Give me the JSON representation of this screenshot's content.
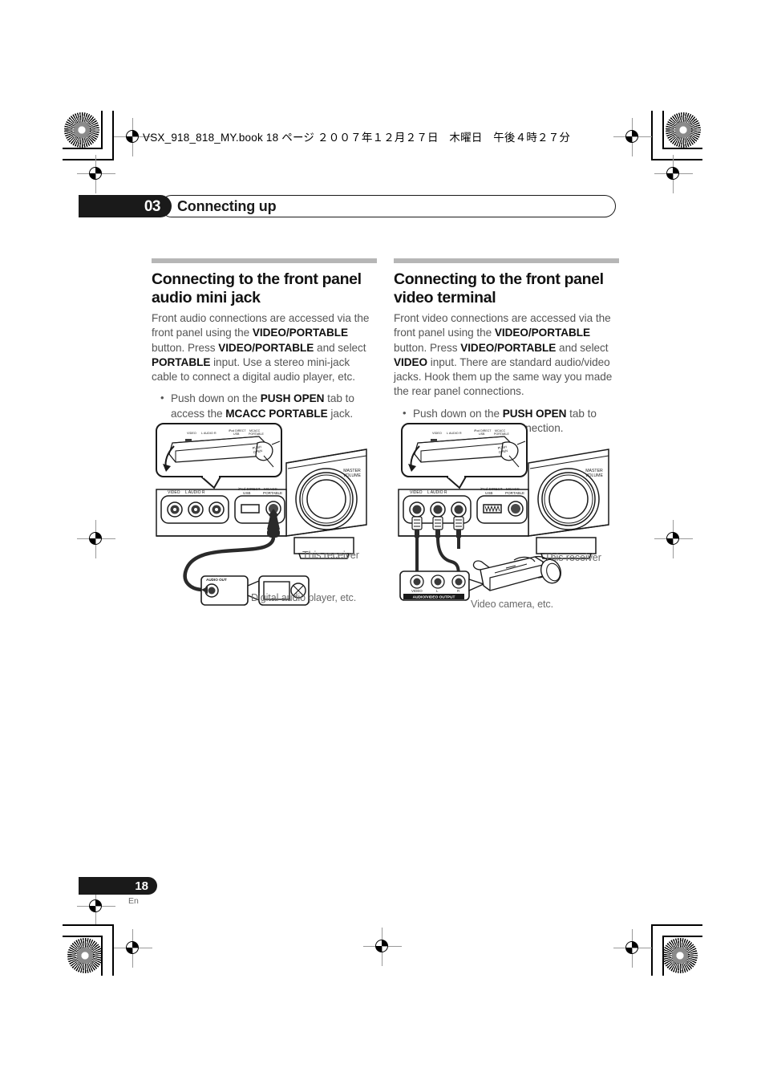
{
  "print_marks": {
    "filename_header": "VSX_918_818_MY.book 18 ページ ２００７年１２月２７日　木曜日　午後４時２７分"
  },
  "chapter": {
    "number": "03",
    "title": "Connecting up"
  },
  "left_column": {
    "heading": "Connecting to the front panel audio mini jack",
    "paragraph_parts": [
      {
        "text": "Front audio connections are accessed via the front panel using the ",
        "bold": false
      },
      {
        "text": "VIDEO/PORTABLE",
        "bold": true
      },
      {
        "text": " button. Press ",
        "bold": false
      },
      {
        "text": "VIDEO/PORTABLE",
        "bold": true
      },
      {
        "text": " and select ",
        "bold": false
      },
      {
        "text": "PORTABLE",
        "bold": true
      },
      {
        "text": " input. Use a stereo mini-jack cable to connect a digital audio player, etc.",
        "bold": false
      }
    ],
    "bullets": [
      [
        {
          "text": "Push down on the ",
          "bold": false
        },
        {
          "text": "PUSH OPEN",
          "bold": true
        },
        {
          "text": " tab to access the ",
          "bold": false
        },
        {
          "text": "MCACC PORTABLE",
          "bold": true
        },
        {
          "text": " jack.",
          "bold": false
        }
      ]
    ],
    "figure": {
      "callout_label": "PUSH OPEN",
      "panel_labels": [
        "VIDEO",
        "L  AUDIO  R",
        "iPod DIRECT USB",
        "MCACC PORTABLE"
      ],
      "knob_label": "MASTER VOLUME",
      "device_callout": "AUDIO OUT",
      "caption_receiver": "This receiver",
      "caption_device": "Digital audio player, etc."
    }
  },
  "right_column": {
    "heading": "Connecting to the front panel video terminal",
    "paragraph_parts": [
      {
        "text": "Front video connections are accessed via the front panel using the ",
        "bold": false
      },
      {
        "text": "VIDEO/PORTABLE",
        "bold": true
      },
      {
        "text": " button. Press ",
        "bold": false
      },
      {
        "text": "VIDEO/PORTABLE",
        "bold": true
      },
      {
        "text": " and select ",
        "bold": false
      },
      {
        "text": "VIDEO",
        "bold": true
      },
      {
        "text": " input. There are standard audio/video jacks. Hook them up the same way you made the rear panel connections.",
        "bold": false
      }
    ],
    "bullets": [
      [
        {
          "text": "Push down on the ",
          "bold": false
        },
        {
          "text": "PUSH OPEN",
          "bold": true
        },
        {
          "text": " tab to access audio/video connection.",
          "bold": false
        }
      ]
    ],
    "figure": {
      "callout_label": "PUSH OPEN",
      "panel_labels": [
        "VIDEO",
        "L  AUDIO  R",
        "iPod DIRECT USB",
        "MCACC PORTABLE"
      ],
      "knob_label": "MASTER VOLUME",
      "device_jack_labels": [
        "VIDEO",
        "L",
        "R"
      ],
      "device_callout": "AUDIO/VIDEO OUTPUT",
      "caption_receiver": "This receiver",
      "caption_device": "Video camera, etc."
    }
  },
  "footer": {
    "page_number": "18",
    "language_code": "En"
  },
  "colors": {
    "chapter_bar": "#1a1a1a",
    "rule": "#b6b6b6",
    "body_text": "#555555",
    "caption_text": "#6a6a6a"
  }
}
